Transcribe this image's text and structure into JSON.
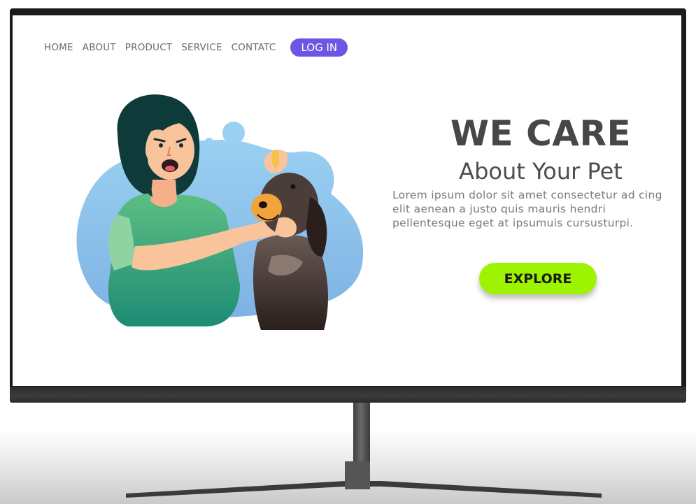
{
  "nav": {
    "links": [
      "HOME",
      "ABOUT",
      "PRODUCT",
      "SERVICE",
      "CONTATC"
    ],
    "login_label": "LOG IN"
  },
  "hero": {
    "title": "WE CARE",
    "subtitle": "About Your Pet",
    "body": "Lorem ipsum dolor sit amet consectetur ad cing elit aenean a justo quis mauris hendri pellentesque eget at ipsumuis cursusturpi.",
    "explore_label": "EXPLORE"
  },
  "colors": {
    "login_button": "#6c56e4",
    "explore_button": "#9ef400",
    "title_text": "#474747",
    "blob": "#8cc3ec"
  },
  "icons": {
    "illustration": "woman-giving-dog-eye-drops-illustration"
  }
}
